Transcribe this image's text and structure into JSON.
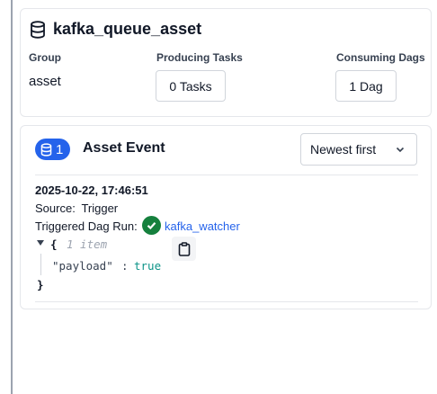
{
  "asset": {
    "title": "kafka_queue_asset",
    "icon": "database-icon",
    "group_label": "Group",
    "group_value": "asset",
    "producing_label": "Producing Tasks",
    "producing_button": "0 Tasks",
    "consuming_label": "Consuming Dags",
    "consuming_button": "1 Dag"
  },
  "events": {
    "count": "1",
    "title": "Asset Event",
    "sort": "Newest first",
    "items": [
      {
        "timestamp": "2025-10-22, 17:46:51",
        "source_label": "Source:",
        "source_value": "Trigger",
        "triggered_label": "Triggered Dag Run:",
        "dag_run": "kafka_watcher",
        "extra": {
          "open": "{",
          "count": "1 item",
          "key": "\"payload\"",
          "colon": ":",
          "value": "true",
          "close": "}"
        }
      }
    ]
  },
  "colors": {
    "accent": "#2563eb",
    "success": "#15803d",
    "json_value": "#0d9488"
  }
}
